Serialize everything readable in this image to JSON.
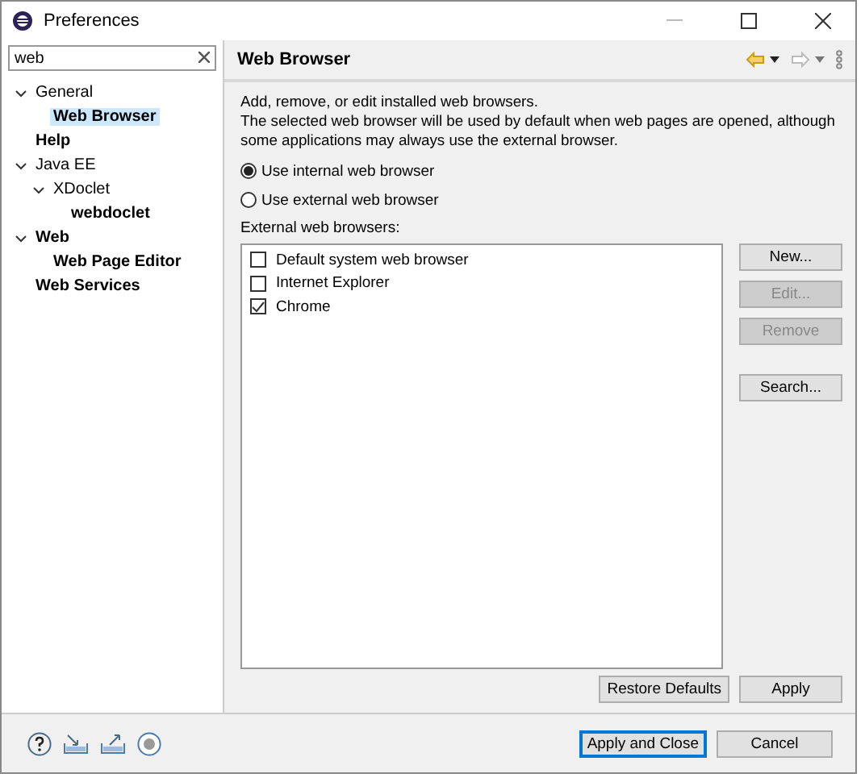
{
  "window": {
    "title": "Preferences"
  },
  "filter": {
    "value": "web"
  },
  "tree": [
    {
      "label": "General",
      "matched": false,
      "selected": false,
      "expanded": true,
      "children": [
        {
          "label": "Web Browser",
          "matched": true,
          "selected": true
        }
      ]
    },
    {
      "label": "Help",
      "matched": true,
      "selected": false
    },
    {
      "label": "Java EE",
      "matched": false,
      "selected": false,
      "expanded": true,
      "children": [
        {
          "label": "XDoclet",
          "matched": false,
          "selected": false,
          "expanded": true,
          "children": [
            {
              "label": "webdoclet",
              "matched": true,
              "selected": false
            }
          ]
        }
      ]
    },
    {
      "label": "Web",
      "matched": true,
      "selected": false,
      "expanded": true,
      "children": [
        {
          "label": "Web Page Editor",
          "matched": true,
          "selected": false
        }
      ]
    },
    {
      "label": "Web Services",
      "matched": true,
      "selected": false
    }
  ],
  "page": {
    "title": "Web Browser",
    "description": [
      "Add, remove, or edit installed web browsers.",
      "The selected web browser will be used by default when web pages are opened, although some applications may always use the external browser."
    ],
    "radios": [
      {
        "label": "Use internal web browser",
        "selected": true
      },
      {
        "label": "Use external web browser",
        "selected": false
      }
    ],
    "list_label": "External web browsers:",
    "browsers": [
      {
        "label": "Default system web browser",
        "checked": false
      },
      {
        "label": "Internet Explorer",
        "checked": false
      },
      {
        "label": "Chrome",
        "checked": true
      }
    ],
    "side_buttons": [
      {
        "label": "New...",
        "disabled": false
      },
      {
        "label": "Edit...",
        "disabled": true
      },
      {
        "label": "Remove",
        "disabled": true
      },
      {
        "label": "Search...",
        "disabled": false
      }
    ],
    "page_buttons": [
      "Restore Defaults",
      "Apply"
    ]
  },
  "footer_buttons": [
    {
      "label": "Apply and Close",
      "default": true
    },
    {
      "label": "Cancel",
      "default": false
    }
  ]
}
